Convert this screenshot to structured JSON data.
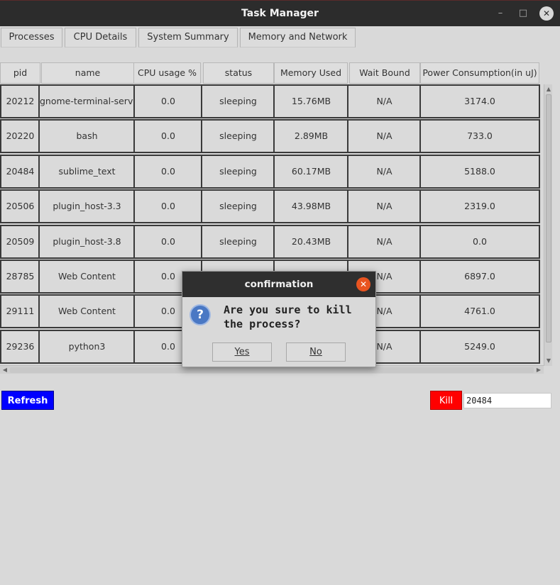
{
  "window": {
    "title": "Task Manager",
    "controls": {
      "minimize": "–",
      "maximize": "□",
      "close": "✕"
    }
  },
  "tabs": [
    "Processes",
    "CPU Details",
    "System Summary",
    "Memory and Network"
  ],
  "table": {
    "headers": [
      "pid",
      "name",
      "CPU usage %",
      "status",
      "Memory Used",
      "Wait Bound",
      "Power Consumption(in uJ)"
    ],
    "rows": [
      [
        "20212",
        "gnome-terminal-server",
        "0.0",
        "sleeping",
        "15.76MB",
        "N/A",
        "3174.0"
      ],
      [
        "20220",
        "bash",
        "0.0",
        "sleeping",
        "2.89MB",
        "N/A",
        "733.0"
      ],
      [
        "20484",
        "sublime_text",
        "0.0",
        "sleeping",
        "60.17MB",
        "N/A",
        "5188.0"
      ],
      [
        "20506",
        "plugin_host-3.3",
        "0.0",
        "sleeping",
        "43.98MB",
        "N/A",
        "2319.0"
      ],
      [
        "20509",
        "plugin_host-3.8",
        "0.0",
        "sleeping",
        "20.43MB",
        "N/A",
        "0.0"
      ],
      [
        "28785",
        "Web Content",
        "0.0",
        "",
        "",
        "N/A",
        "6897.0"
      ],
      [
        "29111",
        "Web Content",
        "0.0",
        "",
        "",
        "N/A",
        "4761.0"
      ],
      [
        "29236",
        "python3",
        "0.0",
        "",
        "",
        "N/A",
        "5249.0"
      ]
    ]
  },
  "actions": {
    "refresh_label": "Refresh",
    "kill_label": "Kill",
    "pid_value": "20484"
  },
  "dialog": {
    "title": "confirmation",
    "message": "Are you sure to kill the process?",
    "yes_label": "Yes",
    "no_label": "No",
    "icon": "question-icon"
  },
  "colors": {
    "refresh_bg": "#0000ff",
    "kill_bg": "#ff0000",
    "titlebar_bg": "#2c2c2c",
    "dialog_close_bg": "#e95420"
  }
}
